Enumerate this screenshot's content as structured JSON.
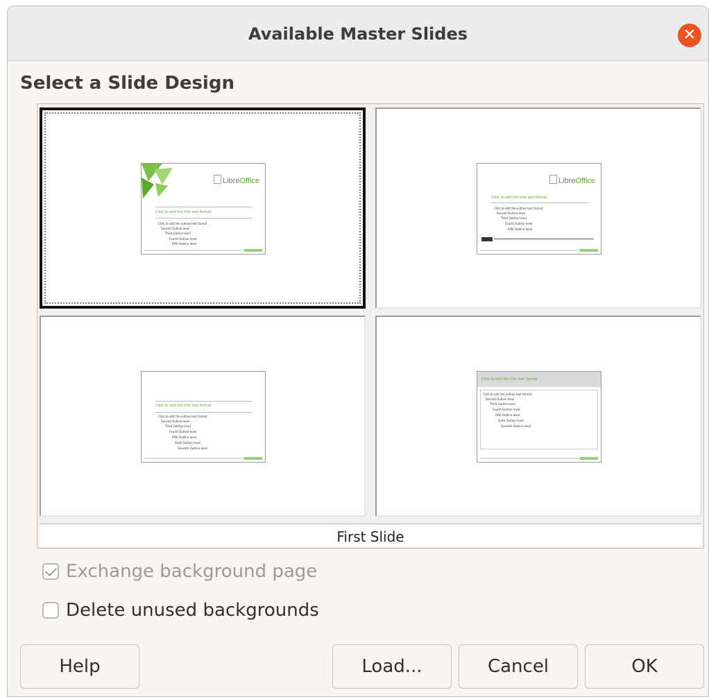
{
  "window": {
    "title": "Available Master Slides"
  },
  "section": {
    "title": "Select a Slide Design"
  },
  "selected_design_caption": "First Slide",
  "thumbnail_text": {
    "logo_brand_1": "Libre",
    "logo_brand_2": "Office",
    "title_placeholder": "Click to edit the title text format",
    "outline_1": "Click to edit the outline text format",
    "outline_2": "Second Outline level",
    "outline_3": "Third Outline level",
    "outline_4": "Fourth Outline level",
    "outline_5": "Fifth Outline level",
    "outline_6": "Sixth Outline level",
    "outline_7": "Seventh Outline level"
  },
  "options": {
    "exchange_background": {
      "label": "Exchange background page",
      "checked": true,
      "enabled": false
    },
    "delete_unused": {
      "label": "Delete unused backgrounds",
      "checked": false,
      "enabled": true
    }
  },
  "buttons": {
    "help": "Help",
    "load": "Load...",
    "cancel": "Cancel",
    "ok": "OK"
  },
  "colors": {
    "accent_close": "#e95420",
    "libreoffice_green": "#5ca82e"
  },
  "icons": {
    "close": "close-icon",
    "check": "check-icon"
  }
}
